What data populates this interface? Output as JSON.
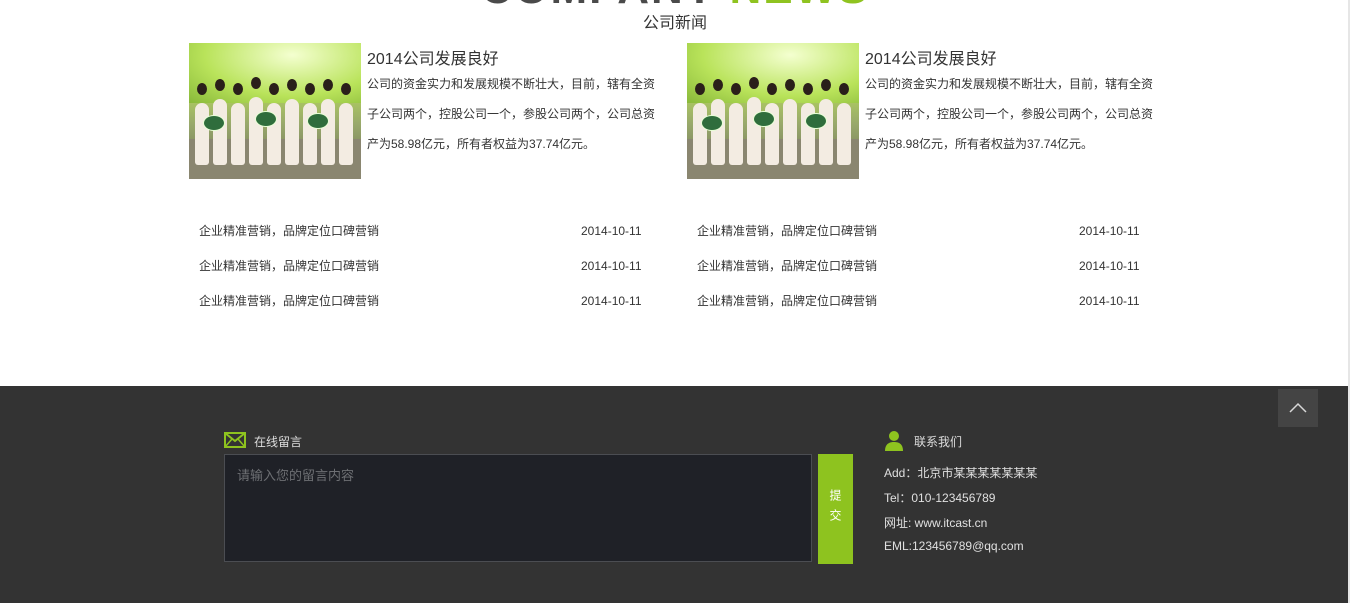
{
  "header": {
    "title_word1": "COMPANY",
    "title_word2": "NEWS",
    "subtitle": "公司新闻"
  },
  "features": [
    {
      "title": "2014公司发展良好",
      "description": "公司的资金实力和发展规模不断壮大，目前，辖有全资子公司两个，控股公司一个，参股公司两个，公司总资产为58.98亿元，所有者权益为37.74亿元。",
      "image": "photo-promo-girls"
    },
    {
      "title": "2014公司发展良好",
      "description": "公司的资金实力和发展规模不断壮大，目前，辖有全资子公司两个，控股公司一个，参股公司两个，公司总资产为58.98亿元，所有者权益为37.74亿元。",
      "image": "photo-promo-girls"
    }
  ],
  "news_left": [
    {
      "text": "企业精准营销，品牌定位口碑营销",
      "date": "2014-10-11"
    },
    {
      "text": "企业精准营销，品牌定位口碑营销",
      "date": "2014-10-11"
    },
    {
      "text": "企业精准营销，品牌定位口碑营销",
      "date": "2014-10-11"
    }
  ],
  "news_right": [
    {
      "text": "企业精准营销，品牌定位口碑营销",
      "date": "2014-10-11"
    },
    {
      "text": "企业精准营销，品牌定位口碑营销",
      "date": "2014-10-11"
    },
    {
      "text": "企业精准营销，品牌定位口碑营销",
      "date": "2014-10-11"
    }
  ],
  "footer": {
    "message_label": "在线留言",
    "message_placeholder": "请输入您的留言内容",
    "submit_label": "提交",
    "contact_label": "联系我们",
    "contact_lines": [
      "Add：北京市某某某某某某某",
      "Tel：010-123456789",
      "网址: www.itcast.cn",
      "EML:123456789@qq.com"
    ],
    "message_icon": "envelope-icon",
    "contact_icon": "user-icon",
    "back_top_icon": "chevron-up-icon"
  },
  "colors": {
    "accent": "#8ec31f",
    "footer_bg": "#333333",
    "text": "#333333"
  }
}
